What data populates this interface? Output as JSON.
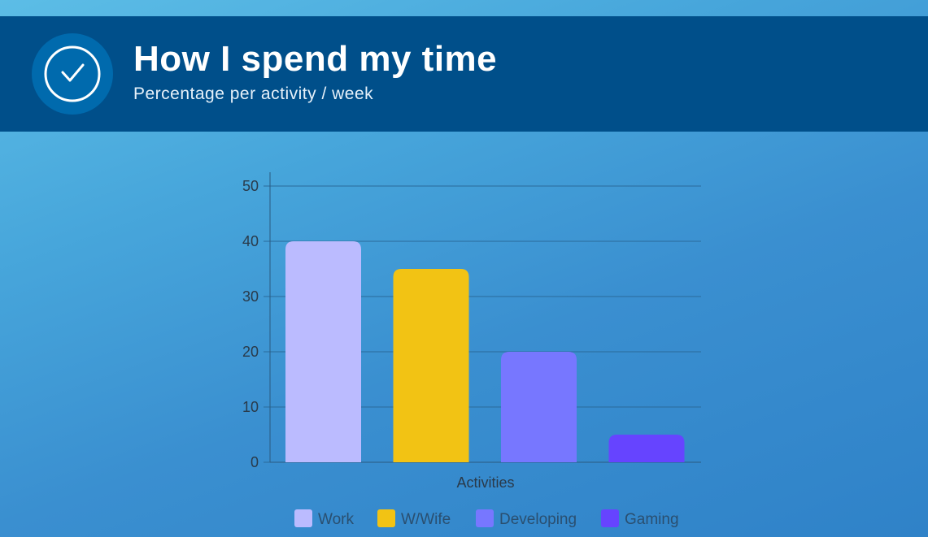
{
  "header": {
    "title": "How I spend my time",
    "subtitle": "Percentage per activity / week",
    "icon": "clock-check-icon"
  },
  "colors": {
    "header_bg": "#004f8a",
    "icon_bg": "#006aad"
  },
  "chart_data": {
    "type": "bar",
    "title": "",
    "xlabel": "Activities",
    "ylabel": "",
    "ylim": [
      0,
      50
    ],
    "yticks": [
      0,
      10,
      20,
      30,
      40,
      50
    ],
    "grid": true,
    "legend_position": "bottom",
    "series": [
      {
        "name": "Work",
        "value": 40,
        "color": "#bbbbff"
      },
      {
        "name": "W/Wife",
        "value": 35,
        "color": "#f2c314"
      },
      {
        "name": "Developing",
        "value": 20,
        "color": "#7777ff"
      },
      {
        "name": "Gaming",
        "value": 5,
        "color": "#6644ff"
      }
    ]
  }
}
